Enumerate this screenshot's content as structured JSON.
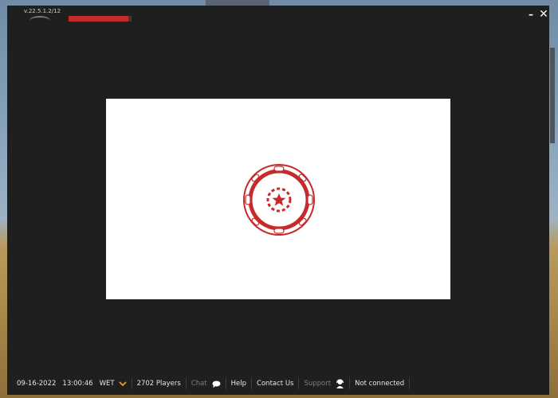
{
  "app": {
    "version": "v.22.5.1.2/12",
    "progress_fraction": 0.95
  },
  "status_bar": {
    "date": "09-16-2022",
    "time": "13:00:46",
    "timezone": "WET",
    "players": "2702 Players",
    "chat_label": "Chat",
    "help_label": "Help",
    "contact_label": "Contact Us",
    "support_label": "Support",
    "connection_status": "Not connected"
  },
  "colors": {
    "accent_red": "#c62a2a",
    "chevron_orange": "#e8a020",
    "window_bg": "#1f1f1f"
  },
  "icons": {
    "loading": "poker-chip-spinner-icon",
    "chat": "speech-bubble-icon",
    "support": "headset-agent-icon",
    "timezone_toggle": "chevron-down-icon",
    "minimize": "minimize-icon",
    "close": "close-icon"
  }
}
